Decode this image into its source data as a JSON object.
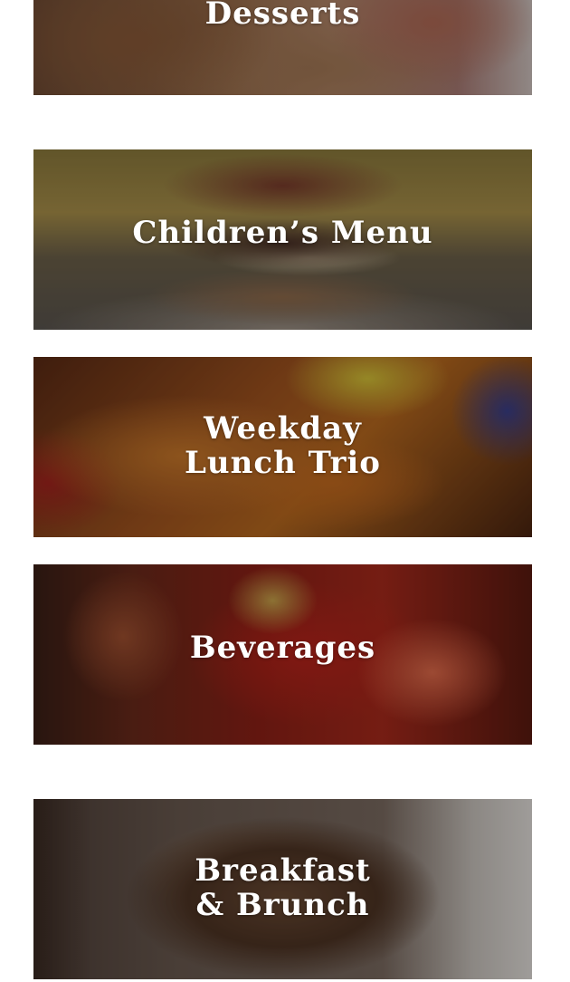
{
  "menu_categories": [
    {
      "id": "desserts",
      "lines": [
        "Desserts"
      ]
    },
    {
      "id": "children",
      "lines": [
        "Children’s Menu"
      ]
    },
    {
      "id": "lunch",
      "lines": [
        "Weekday",
        "Lunch Trio"
      ]
    },
    {
      "id": "beverages",
      "lines": [
        "Beverages"
      ]
    },
    {
      "id": "breakfast",
      "lines": [
        "Breakfast",
        "& Brunch"
      ]
    }
  ],
  "colors": {
    "label_text": "#ffffff",
    "page_background": "#ffffff"
  }
}
